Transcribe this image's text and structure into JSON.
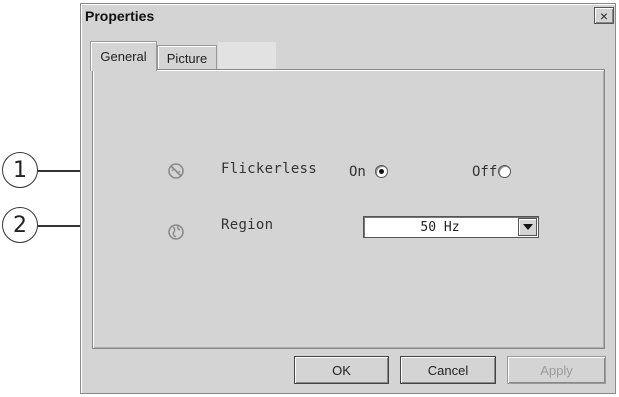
{
  "callouts": [
    "1",
    "2"
  ],
  "window": {
    "title": "Properties",
    "close_label": "×"
  },
  "tabs": [
    {
      "label": "General",
      "active": true
    },
    {
      "label": "Picture",
      "active": false
    }
  ],
  "rows": {
    "flickerless": {
      "icon": "flickerless-icon",
      "label": "Flickerless",
      "options": [
        {
          "label": "On",
          "checked": true
        },
        {
          "label": "Off",
          "checked": false
        }
      ]
    },
    "region": {
      "icon": "region-globe-icon",
      "label": "Region",
      "value": "50 Hz"
    }
  },
  "buttons": {
    "ok": "OK",
    "cancel": "Cancel",
    "apply": "Apply"
  },
  "colors": {
    "dialog_bg": "#d4d4d4",
    "disabled_text": "#9a9a9a"
  }
}
